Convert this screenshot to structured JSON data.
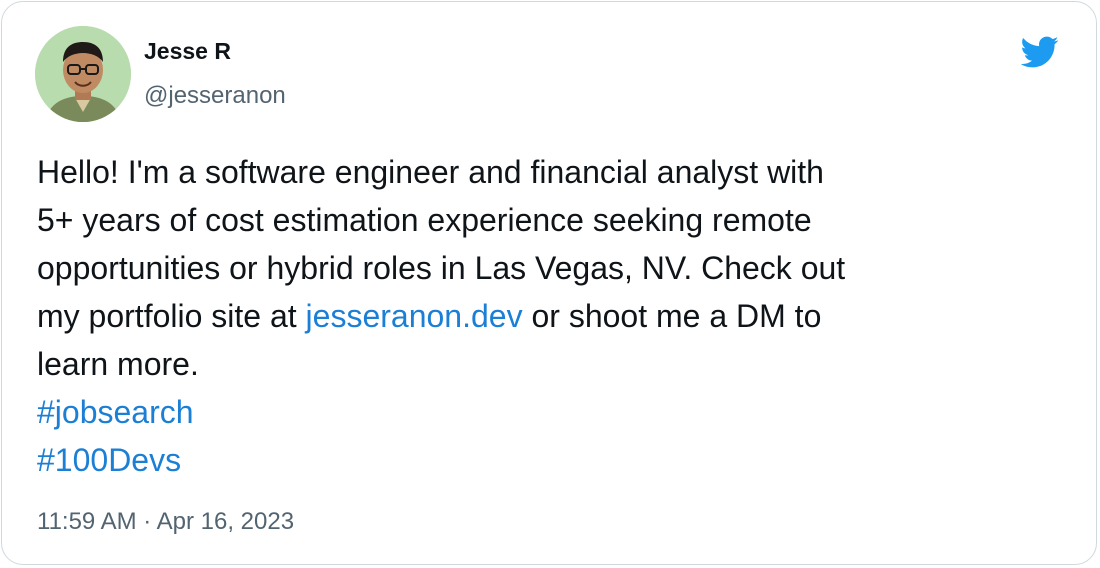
{
  "author": {
    "display_name": "Jesse R",
    "handle": "@jesseranon",
    "avatar_icon": "user-avatar-photo"
  },
  "brand": {
    "logo_icon": "twitter-bird-icon",
    "accent_color": "#1d9bf0"
  },
  "tweet": {
    "line1": "Hello! I'm a software engineer and financial analyst with",
    "line2": "5+ years of cost estimation experience seeking remote",
    "line3": "opportunities or hybrid roles in Las Vegas, NV. Check out",
    "line4_before_link": "my portfolio site at ",
    "link_text": "jesseranon.dev",
    "line4_after_link": " or shoot me a DM to",
    "line5": "learn more.",
    "hashtags": [
      "#jobsearch",
      "#100Devs"
    ]
  },
  "timestamp": "11:59 AM · Apr 16, 2023"
}
